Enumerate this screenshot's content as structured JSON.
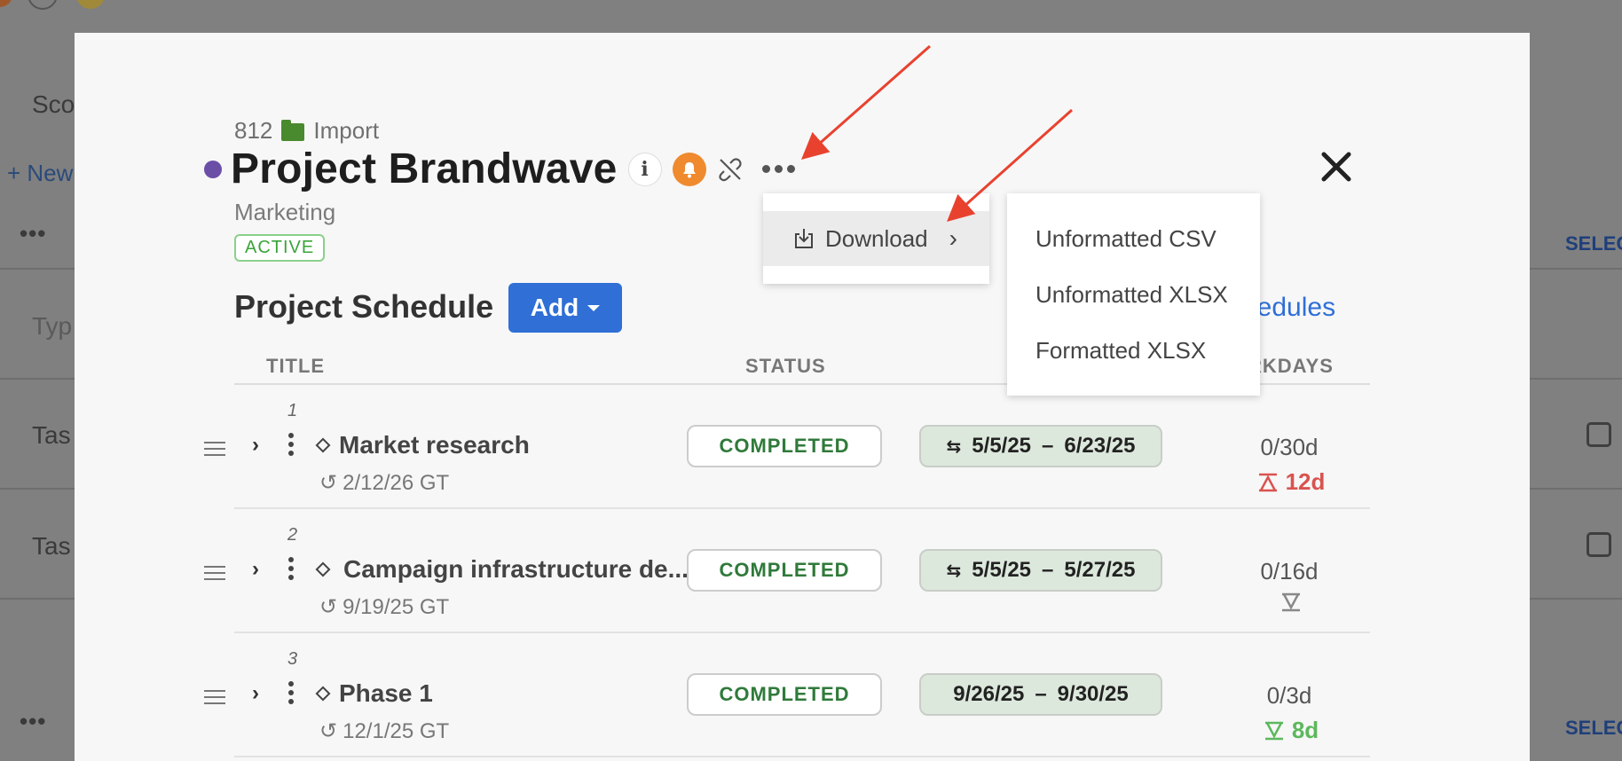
{
  "background": {
    "heading_partial": "Sco",
    "new_link": "+ New",
    "type_placeholder_partial": "Typ",
    "task_partial_1": "Tas",
    "task_partial_2": "Tas",
    "select_label_1": "SELEC",
    "select_label_2": "SELEC"
  },
  "project": {
    "number": "812",
    "folder": "Import",
    "title": "Project Brandwave",
    "department": "Marketing",
    "status": "ACTIVE",
    "dot_color": "#6b4fa7"
  },
  "schedule": {
    "section_title": "Project Schedule",
    "add_label": "Add",
    "link_partial": "hedules",
    "columns": {
      "title": "TITLE",
      "status": "STATUS",
      "workdays_partial": "RKDAYS"
    },
    "rows": [
      {
        "num": "1",
        "title": "Market research",
        "date": "2/12/26 GT",
        "status": "COMPLETED",
        "start": "5/5/25",
        "end": "6/23/25",
        "has_link_icon": true,
        "workdays": "0/30d",
        "delta": "12d",
        "delta_color": "#d9534f",
        "delta_icon": "hourglass-up-icon"
      },
      {
        "num": "2",
        "title": "Campaign infrastructure de...",
        "date": "9/19/25 GT",
        "status": "COMPLETED",
        "start": "5/5/25",
        "end": "5/27/25",
        "has_link_icon": true,
        "workdays": "0/16d",
        "delta": "",
        "delta_color": "#888888",
        "delta_icon": "hourglass-down-icon"
      },
      {
        "num": "3",
        "title": "Phase 1",
        "date": "12/1/25 GT",
        "status": "COMPLETED",
        "start": "9/26/25",
        "end": "9/30/25",
        "has_link_icon": false,
        "workdays": "0/3d",
        "delta": "8d",
        "delta_color": "#5cb85c",
        "delta_icon": "hourglass-down-icon"
      }
    ]
  },
  "menus": {
    "primary": {
      "download_label": "Download"
    },
    "submenu": {
      "items": [
        "Unformatted CSV",
        "Unformatted XLSX",
        "Formatted XLSX"
      ]
    }
  },
  "colors": {
    "accent": "#2f6fd6",
    "bell": "#ef8a2e",
    "completed_text": "#2f7a3a",
    "range_bg": "#dde8dd",
    "arrow": "#e8422f"
  }
}
